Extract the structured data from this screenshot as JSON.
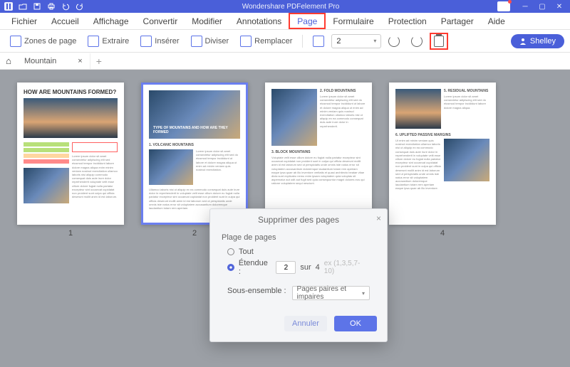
{
  "app": {
    "title": "Wondershare PDFelement Pro"
  },
  "menu": {
    "items": [
      "Fichier",
      "Accueil",
      "Affichage",
      "Convertir",
      "Modifier",
      "Annotations",
      "Page",
      "Formulaire",
      "Protection",
      "Partager",
      "Aide"
    ],
    "active_index": 6
  },
  "toolbar": {
    "zones": "Zones de page",
    "extract": "Extraire",
    "insert": "Insérer",
    "split": "Diviser",
    "replace": "Remplacer",
    "page_value": "2",
    "user": "Shelley"
  },
  "tabs": {
    "doc_name": "Mountain",
    "close": "×",
    "add": "+"
  },
  "pages": {
    "count": 4,
    "labels": [
      "1",
      "2",
      "3",
      "4"
    ],
    "selected_index": 1,
    "thumb1_title": "HOW ARE MOUNTAINS FORMED?",
    "thumb2_caption": "TYPE OF MOUNTAINS AND HOW ARE THEY FORMED",
    "thumb2_sub": "1. VOLCANIC MOUNTAINS",
    "thumb3_h1": "2. FOLD MOUNTAINS",
    "thumb3_h2": "3. BLOCK MOUNTAINS",
    "thumb4_h1": "5. RESIDUAL MOUNTAINS",
    "thumb4_h2": "6. UPLIFTED PASSIVE MARGINS"
  },
  "dialog": {
    "title": "Supprimer des pages",
    "section": "Plage de pages",
    "opt_all": "Tout",
    "opt_range": "Étendue :",
    "range_value": "2",
    "of": "sur",
    "total": "4",
    "hint": "ex (1,3,5,7-10)",
    "subset_label": "Sous-ensemble :",
    "subset_value": "Pages paires et impaires",
    "cancel": "Annuler",
    "ok": "OK"
  }
}
